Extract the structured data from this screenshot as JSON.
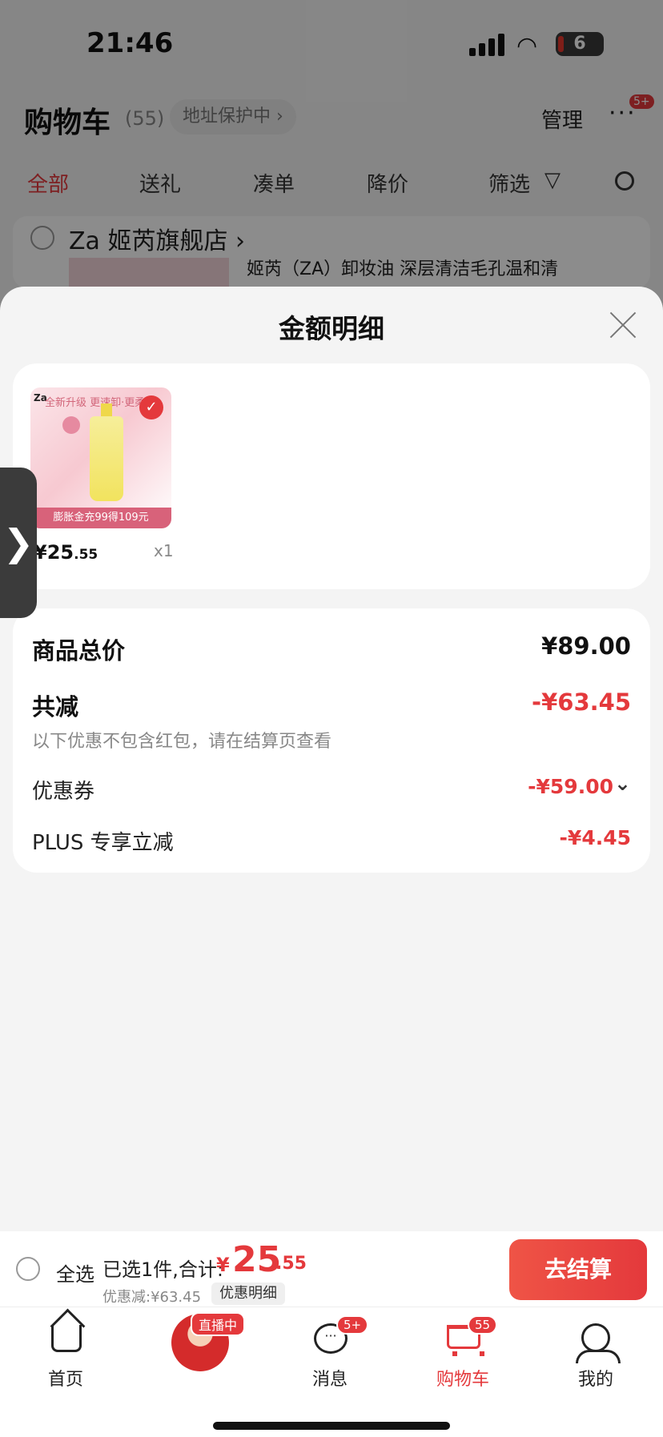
{
  "status_bar": {
    "time": "21:46",
    "battery": "6"
  },
  "background_page": {
    "title": "购物车",
    "count": "(55)",
    "address_pill": "地址保护中 ›",
    "manage": "管理",
    "more": "···",
    "more_badge": "5+",
    "tabs": [
      "全部",
      "送礼",
      "凑单",
      "降价",
      "筛选"
    ],
    "shop_name": "Za 姬芮旗舰店 ›",
    "product_title": "姬芮（ZA）卸妆油 深层清洁毛孔温和清"
  },
  "sheet": {
    "title": "金额明细",
    "item": {
      "image_top_text": "全新升级 更速卸·更柔",
      "image_logo": "Za",
      "image_banner": "膨胀金充99得109元",
      "price_yen": "¥",
      "price_int": "25",
      "price_dec": ".55",
      "qty": "x1"
    },
    "side_tab": "❯",
    "summary": {
      "total_label": "商品总价",
      "total_value": "¥89.00",
      "reduce_label": "共减",
      "reduce_value": "-¥63.45",
      "note": "以下优惠不包含红包，请在结算页查看",
      "coupon_label": "优惠券",
      "coupon_value": "-¥59.00",
      "coupon_chevron": "⌄",
      "plus_label": "PLUS 专享立减",
      "plus_value": "-¥4.45"
    }
  },
  "checkout": {
    "select_all": "全选",
    "selected_text": "已选1件,合计:",
    "total_yen": "¥",
    "total_int": "25",
    "total_dec": ".55",
    "discount_text": "优惠减:¥63.45",
    "detail_label": "优惠明细",
    "pay_label": "去结算"
  },
  "tabbar": {
    "tabs": [
      {
        "label": "首页",
        "icon": "home-icon"
      },
      {
        "label": "",
        "icon": "live-avatar",
        "badge": "直播中"
      },
      {
        "label": "消息",
        "icon": "message-icon",
        "badge": "5+"
      },
      {
        "label": "购物车",
        "icon": "cart-icon",
        "badge": "55"
      },
      {
        "label": "我的",
        "icon": "profile-icon"
      }
    ]
  },
  "colors": {
    "accent": "#e4393c",
    "background": "#f4f4f4"
  }
}
